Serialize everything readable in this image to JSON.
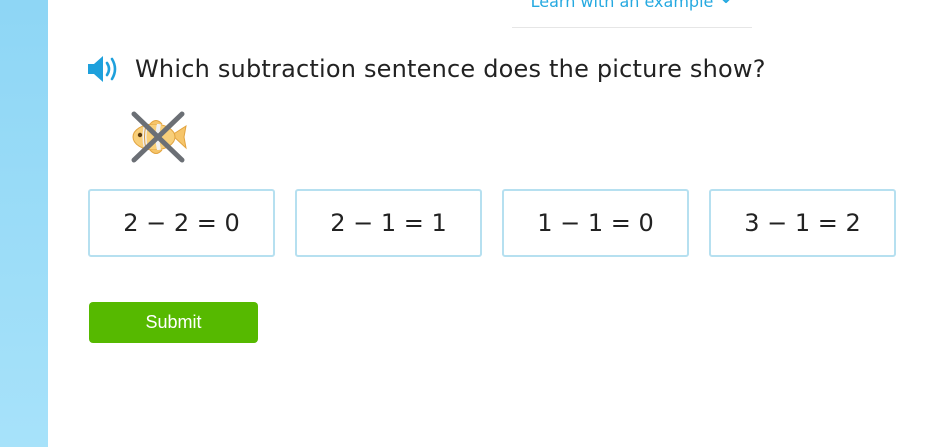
{
  "learn_link": {
    "label": "Learn with an example",
    "icon": "chevron-down-icon"
  },
  "question": {
    "audio_icon": "speaker-icon",
    "text": "Which subtraction sentence does the picture show?"
  },
  "picture": {
    "items": [
      {
        "icon": "fish-icon",
        "crossed_out": true
      }
    ]
  },
  "choices": [
    {
      "label": "2 − 2 = 0"
    },
    {
      "label": "2 − 1 = 1"
    },
    {
      "label": "1 − 1 = 0"
    },
    {
      "label": "3 − 1 = 2"
    }
  ],
  "submit": {
    "label": "Submit"
  },
  "colors": {
    "accent_blue": "#25a9e0",
    "submit_green": "#56b900",
    "choice_border": "#b6e0f0",
    "rail": "#8ed6f5"
  }
}
